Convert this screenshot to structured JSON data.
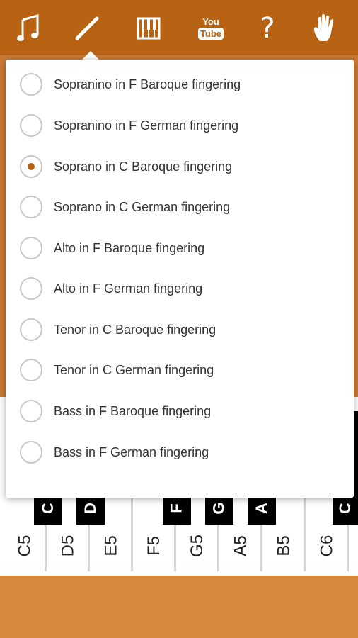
{
  "toolbar": {
    "buttons": [
      {
        "name": "notes-button",
        "icon": "music-note-icon"
      },
      {
        "name": "recorder-button",
        "icon": "recorder-icon"
      },
      {
        "name": "piano-button",
        "icon": "piano-icon"
      },
      {
        "name": "youtube-button",
        "icon": "youtube-icon",
        "you_text": "You",
        "tube_text": "Tube"
      },
      {
        "name": "help-button",
        "icon": "help-icon",
        "text": "?"
      },
      {
        "name": "hand-button",
        "icon": "hand-icon"
      }
    ]
  },
  "fingering_menu": {
    "selected_index": 2,
    "options": [
      "Sopranino in F Baroque fingering",
      "Sopranino in F German fingering",
      "Soprano in C Baroque fingering",
      "Soprano in C German fingering",
      "Alto in F Baroque fingering",
      "Alto in F German fingering",
      "Tenor in C Baroque fingering",
      "Tenor in C German fingering",
      "Bass in F Baroque fingering",
      "Bass in F German fingering"
    ]
  },
  "keyboard": {
    "white_keys": [
      "C5",
      "D5",
      "E5",
      "F5",
      "G5",
      "A5",
      "B5",
      "C6"
    ],
    "black_keys": [
      "C",
      "D",
      "F",
      "G",
      "A",
      "C"
    ]
  },
  "colors": {
    "toolbar": "#b76313",
    "accent": "#b76313",
    "background": "#d58a40"
  }
}
